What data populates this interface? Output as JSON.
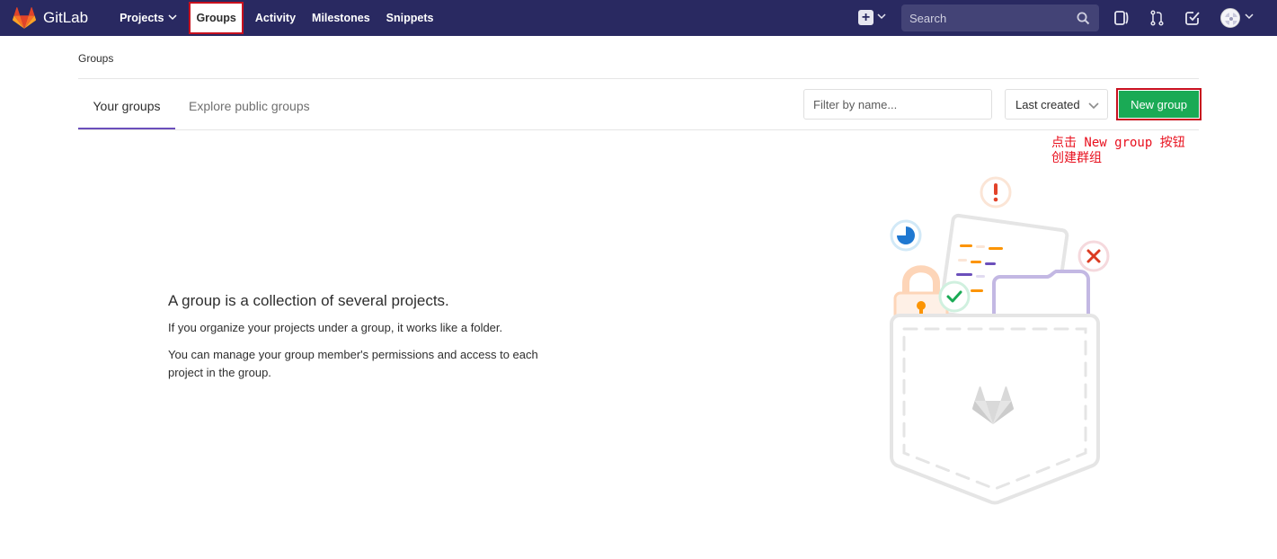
{
  "navbar": {
    "brand": "GitLab",
    "links": [
      {
        "label": "Projects",
        "has_dropdown": true
      },
      {
        "label": "Groups",
        "active": true
      },
      {
        "label": "Activity"
      },
      {
        "label": "Milestones"
      },
      {
        "label": "Snippets"
      }
    ],
    "search_placeholder": "Search",
    "icons": [
      "gitlab-logo-icon",
      "plus-icon",
      "chevron-down-icon",
      "search-icon",
      "issues-icon",
      "merge-request-icon",
      "todo-icon",
      "avatar"
    ],
    "background_color": "#292961"
  },
  "breadcrumb": "Groups",
  "tabs": [
    {
      "label": "Your groups",
      "active": true
    },
    {
      "label": "Explore public groups"
    }
  ],
  "filter_placeholder": "Filter by name...",
  "sort": {
    "selected": "Last created"
  },
  "new_group_label": "New group",
  "annotation": "点击 New group 按钮\n创建群组",
  "empty_state": {
    "title": "A group is a collection of several projects.",
    "paragraph1": "If you organize your projects under a group, it works like a folder.",
    "paragraph2": "You can manage your group member's permissions and access to each project in the group."
  },
  "colors": {
    "accent_purple": "#6b4fbb",
    "success_green": "#1aaa55",
    "highlight_red": "#c8101e"
  }
}
